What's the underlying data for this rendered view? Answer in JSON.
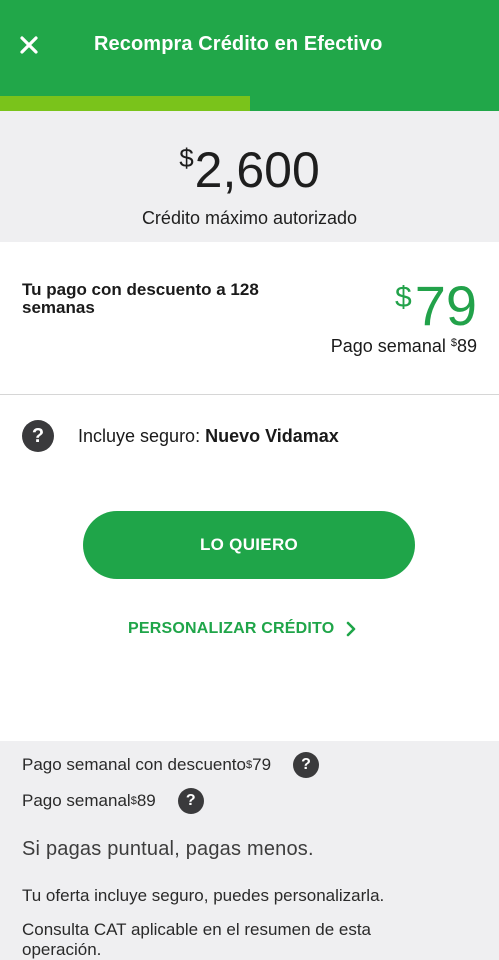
{
  "header": {
    "title": "Recompra Crédito en Efectivo",
    "close_icon": "close-icon",
    "background": "#21a749"
  },
  "progress": {
    "value_fraction": 0.5,
    "fill_color": "#7ac31b",
    "track_color": "#21a749"
  },
  "credit": {
    "currency": "$",
    "amount": "2,600",
    "caption": "Crédito máximo autorizado"
  },
  "payment": {
    "label": "Tu pago con descuento a 128 semanas",
    "currency": "$",
    "amount": "79",
    "weekly_label": "Pago semanal ",
    "weekly_currency": "$",
    "weekly_amount": "89",
    "accent": "#22a24a"
  },
  "insurance": {
    "prefix": "Incluye seguro: ",
    "name": "Nuevo Vidamax",
    "icon": "question-icon"
  },
  "actions": {
    "primary_label": "LO QUIERO",
    "secondary_label": "PERSONALIZAR CRÉDITO",
    "secondary_icon": "chevron-right-icon"
  },
  "summary": {
    "discount_label": "Pago semanal con descuento ",
    "discount_currency": "$",
    "discount_amount": "79",
    "regular_label": "Pago semanal ",
    "regular_currency": "$",
    "regular_amount": "89",
    "slogan": "Si pagas puntual, pagas menos.",
    "note_offer": "Tu oferta incluye seguro, puedes personalizarla.",
    "note_cat": "Consulta CAT aplicable en el resumen de esta operación."
  }
}
